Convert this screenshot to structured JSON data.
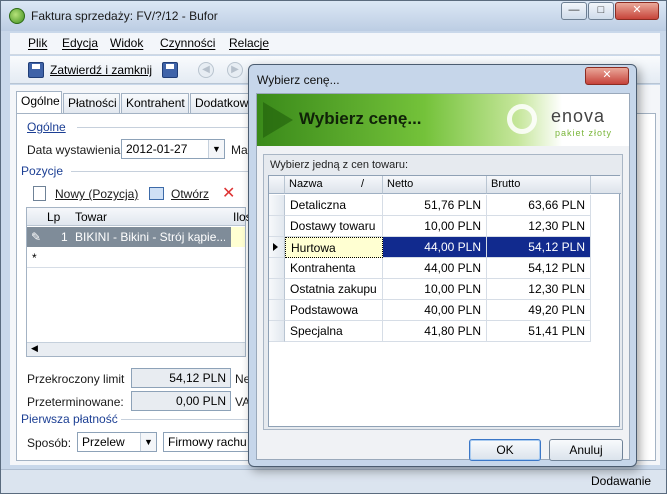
{
  "window": {
    "title": "Faktura sprzedaży: FV/?/12 - Bufor",
    "close_glyph": "✕",
    "min_glyph": "—",
    "max_glyph": "□"
  },
  "menu": [
    "Plik",
    "Edycja",
    "Widok",
    "Czynności",
    "Relacje"
  ],
  "toolbar": {
    "save_close_label": "Zatwierdź i zamknij"
  },
  "tabs": [
    "Ogólne",
    "Płatności",
    "Kontrahent",
    "Dodatkowe"
  ],
  "general": {
    "group_label": "Ogólne",
    "date_label": "Data wystawienia:",
    "date_value": "2012-01-27",
    "partial_label": "Ma"
  },
  "positions": {
    "group_label": "Pozycje",
    "new_label": "Nowy (Pozycja)",
    "open_label": "Otwórz",
    "columns": [
      "Lp",
      "Towar",
      "Ilos"
    ],
    "rows": [
      {
        "lp": "1",
        "towar": "BIKINI - Bikini - Strój kąpie..."
      }
    ],
    "new_row_marker": "*"
  },
  "summary": {
    "limit_label": "Przekroczony limit",
    "limit_value": "54,12 PLN",
    "overdue_label": "Przeterminowane:",
    "overdue_value": "0,00 PLN",
    "netto_partial": "Netto",
    "vat_partial": "VAT"
  },
  "payment": {
    "group_label": "Pierwsza płatność",
    "method_label": "Sposób:",
    "method_value": "Przelew",
    "account_value": "Firmowy rachu"
  },
  "status": {
    "mode": "Dodawanie"
  },
  "dialog": {
    "title": "Wybierz cenę...",
    "banner_title": "Wybierz cenę...",
    "logo_text": "enova",
    "logo_sub": "pakiet złoty",
    "caption": "Wybierz jedną z cen towaru:",
    "columns": {
      "name": "Nazwa",
      "sort_glyph": "/",
      "netto": "Netto",
      "brutto": "Brutto"
    },
    "prices": [
      {
        "name": "Detaliczna",
        "netto": "51,76 PLN",
        "brutto": "63,66 PLN"
      },
      {
        "name": "Dostawy towaru",
        "netto": "10,00 PLN",
        "brutto": "12,30 PLN"
      },
      {
        "name": "Hurtowa",
        "netto": "44,00 PLN",
        "brutto": "54,12 PLN"
      },
      {
        "name": "Kontrahenta",
        "netto": "44,00 PLN",
        "brutto": "54,12 PLN"
      },
      {
        "name": "Ostatnia zakupu",
        "netto": "10,00 PLN",
        "brutto": "12,30 PLN"
      },
      {
        "name": "Podstawowa",
        "netto": "40,00 PLN",
        "brutto": "49,20 PLN"
      },
      {
        "name": "Specjalna",
        "netto": "41,80 PLN",
        "brutto": "51,41 PLN"
      }
    ],
    "ok_label": "OK",
    "cancel_label": "Anuluj"
  },
  "colors": {
    "selection": "#112a8e",
    "group_title": "#1c3f94",
    "banner_green": "#74c23a"
  }
}
